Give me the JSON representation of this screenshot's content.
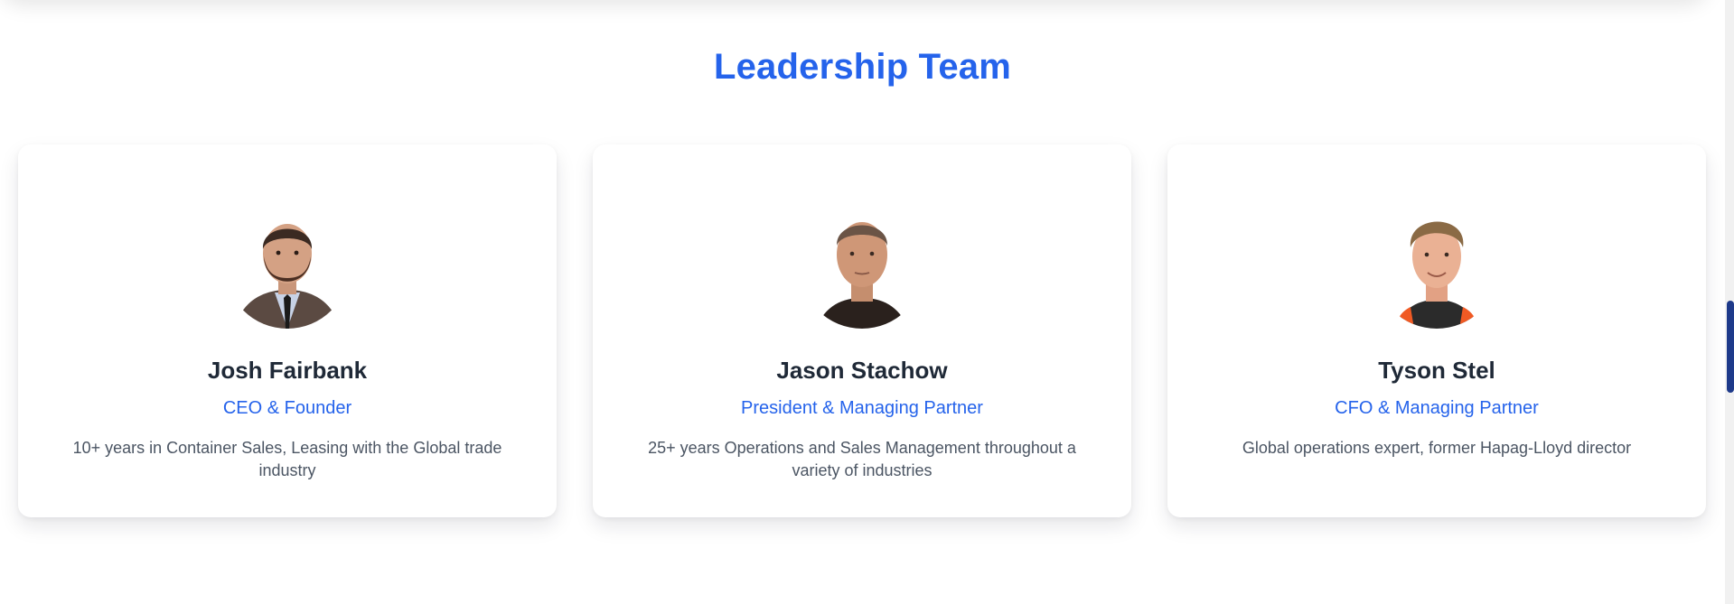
{
  "section": {
    "title": "Leadership Team"
  },
  "team": [
    {
      "name": "Josh Fairbank",
      "role": "CEO & Founder",
      "bio": "10+ years in Container Sales, Leasing with the Global trade industry"
    },
    {
      "name": "Jason Stachow",
      "role": "President & Managing Partner",
      "bio": "25+ years Operations and Sales Management throughout a variety of industries"
    },
    {
      "name": "Tyson Stel",
      "role": "CFO & Managing Partner",
      "bio": "Global operations expert, former Hapag-Lloyd director"
    }
  ],
  "colors": {
    "accent": "#2563eb",
    "heading": "#1f2937",
    "body_text": "#4b5563",
    "scrollbar_thumb": "#1e3a8a"
  }
}
